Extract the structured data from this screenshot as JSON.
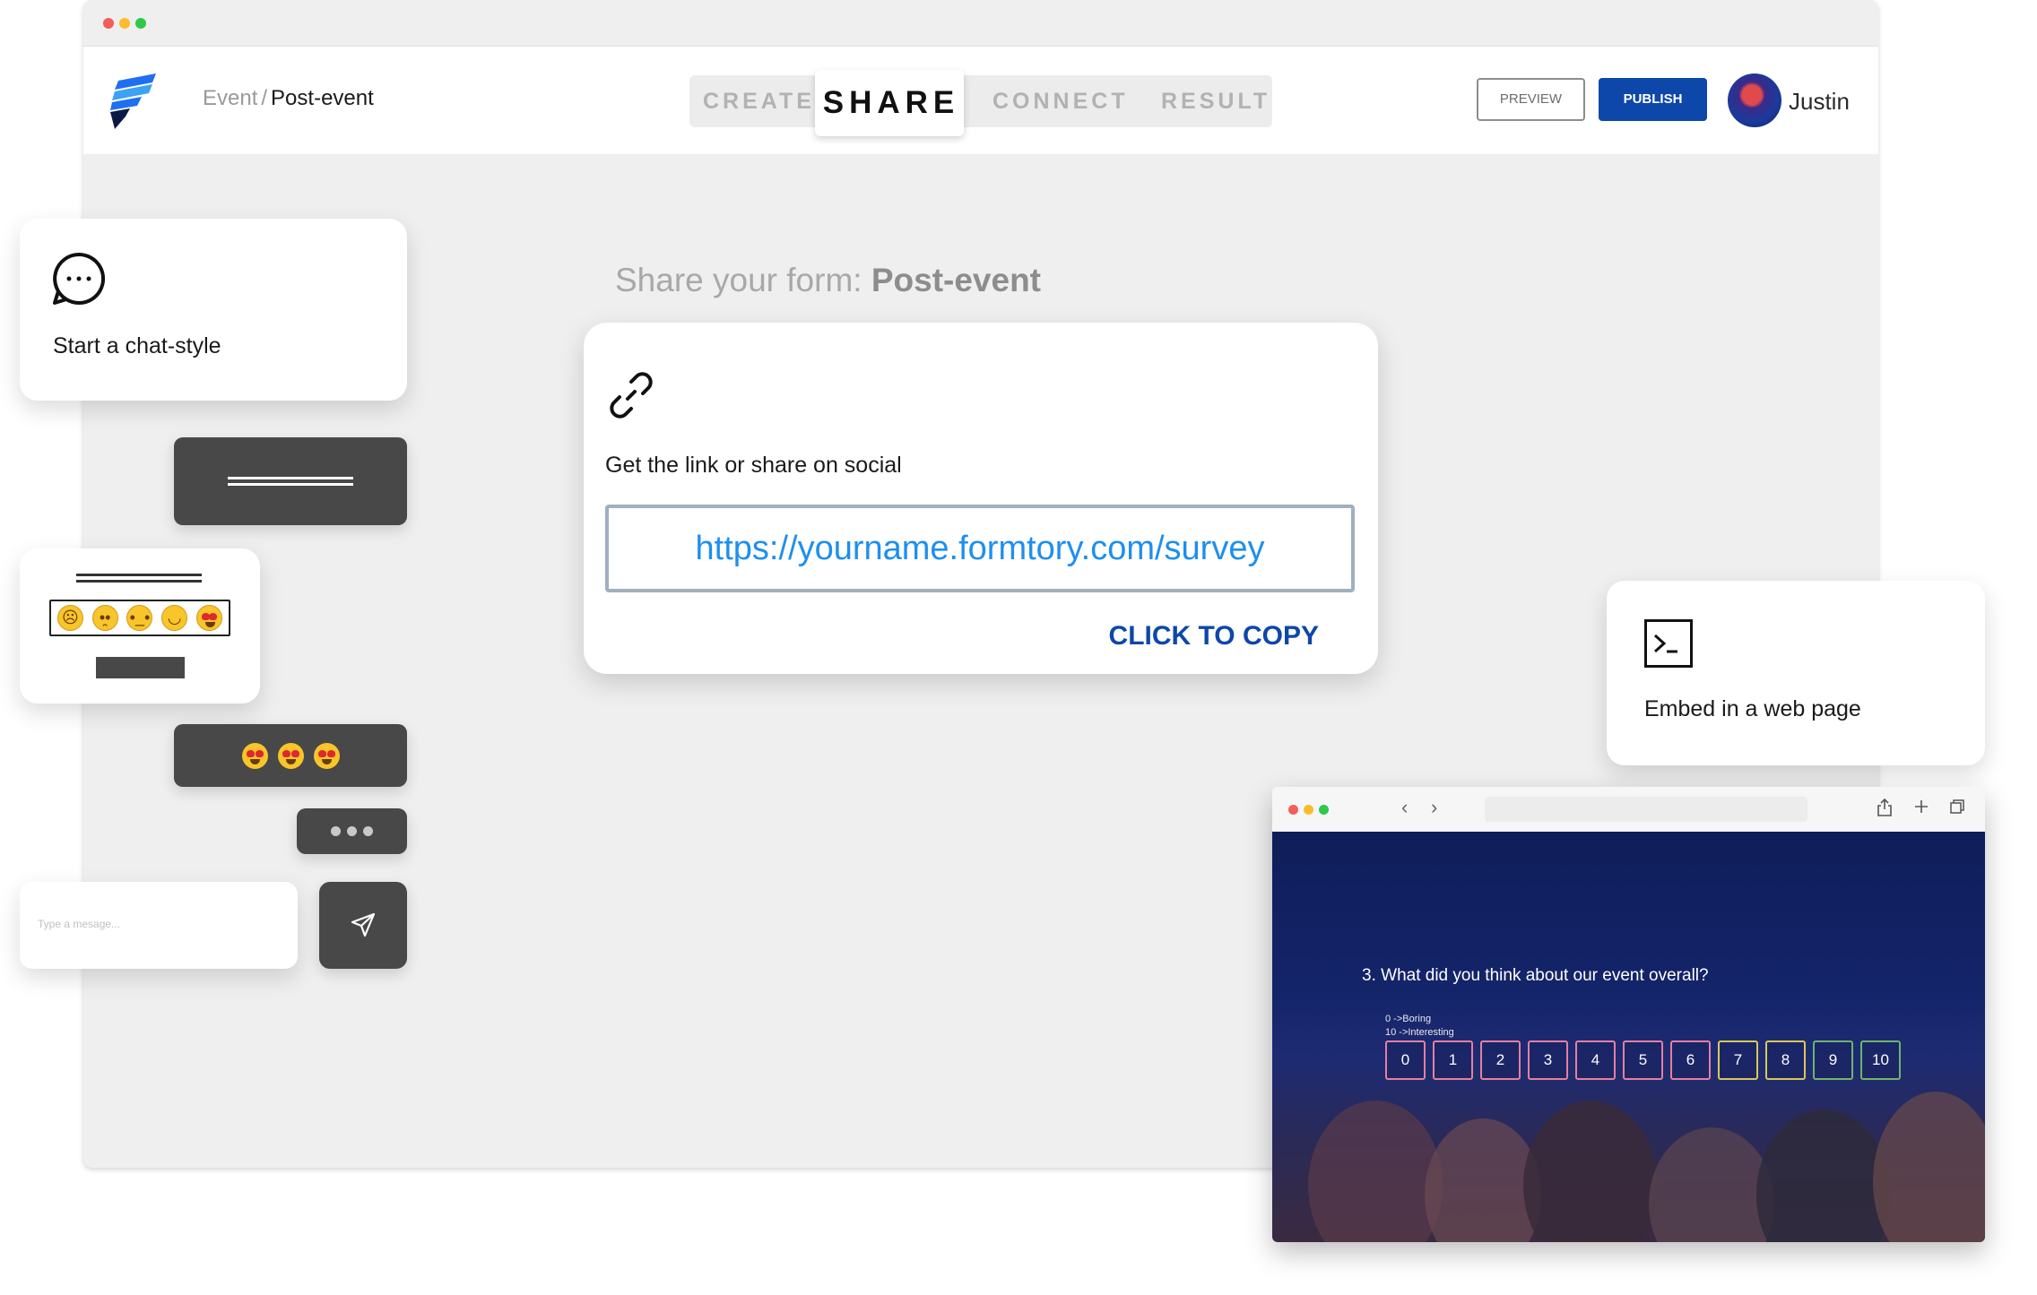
{
  "app": {
    "breadcrumb": {
      "parent": "Event",
      "separator": "/",
      "current": "Post-event"
    },
    "tabs": [
      {
        "label": "CREATE",
        "active": false
      },
      {
        "label": "SHARE",
        "active": true
      },
      {
        "label": "CONNECT",
        "active": false
      },
      {
        "label": "RESULT",
        "active": false
      }
    ],
    "actions": {
      "preview_label": "PREVIEW",
      "publish_label": "PUBLISH"
    },
    "user": {
      "name": "Justin"
    },
    "colors": {
      "accent": "#0d47a9",
      "link": "#1d8ff0"
    }
  },
  "share": {
    "title_prefix": "Share your form:",
    "form_name": "Post-event",
    "link_label": "Get the link or share on social",
    "url": "https://yourname.formtory.com/survey",
    "copy_label": "CLICK TO COPY"
  },
  "chat_card": {
    "label": "Start a chat-style"
  },
  "message_input": {
    "placeholder": "Type a mesage..."
  },
  "embed_card": {
    "label": "Embed in a web page"
  },
  "preview_survey": {
    "question_number": "3.",
    "question": "What did you think about our event overall?",
    "hint_min": "0 ->Boring",
    "hint_max": "10 ->Interesting",
    "scale": [
      "0",
      "1",
      "2",
      "3",
      "4",
      "5",
      "6",
      "7",
      "8",
      "9",
      "10"
    ]
  },
  "icons": [
    "logo-icon",
    "link-icon",
    "chat-bubble-icon",
    "send-icon",
    "terminal-icon",
    "back-icon",
    "forward-icon",
    "share-icon",
    "plus-icon",
    "tabs-icon"
  ]
}
